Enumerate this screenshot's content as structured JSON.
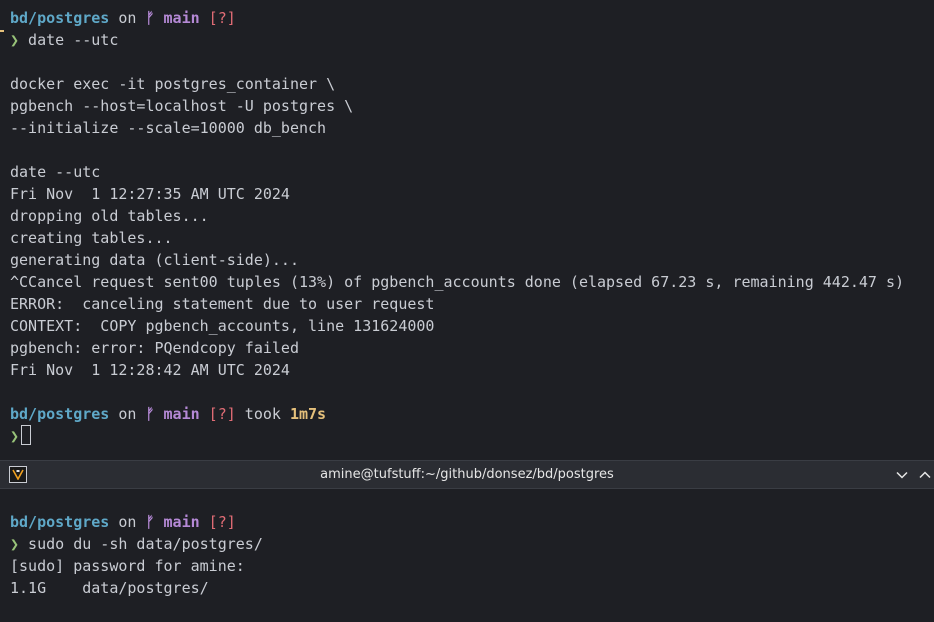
{
  "top_pane": {
    "prompt1": {
      "path": "bd/postgres",
      "on": " on ",
      "branch_glyph": "ᚠ",
      "branch": " main",
      "status": " [?]"
    },
    "cmd1_arrow": "❯",
    "cmd1": " date --utc",
    "lines": [
      "docker exec -it postgres_container \\",
      "pgbench --host=localhost -U postgres \\",
      "--initialize --scale=10000 db_bench",
      "",
      "date --utc",
      "Fri Nov  1 12:27:35 AM UTC 2024",
      "dropping old tables...",
      "creating tables...",
      "generating data (client-side)...",
      "^CCancel request sent00 tuples (13%) of pgbench_accounts done (elapsed 67.23 s, remaining 442.47 s)",
      "ERROR:  canceling statement due to user request",
      "CONTEXT:  COPY pgbench_accounts, line 131624000",
      "pgbench: error: PQendcopy failed",
      "Fri Nov  1 12:28:42 AM UTC 2024"
    ],
    "prompt2": {
      "path": "bd/postgres",
      "on": " on ",
      "branch_glyph": "ᚠ",
      "branch": " main",
      "status": " [?]",
      "took": " took ",
      "duration": "1m7s"
    },
    "cmd2_arrow": "❯"
  },
  "divider": {
    "title": "amine@tufstuff:~/github/donsez/bd/postgres",
    "icons": [
      "terminal-app-icon",
      "chevron-down-icon",
      "chevron-up-icon"
    ]
  },
  "bottom_pane": {
    "prompt": {
      "path": "bd/postgres",
      "on": " on ",
      "branch_glyph": "ᚠ",
      "branch": " main",
      "status": " [?]"
    },
    "cmd_arrow": "❯",
    "cmd": " sudo du -sh data/postgres/",
    "lines": [
      "[sudo] password for amine:",
      "1.1G    data/postgres/"
    ]
  },
  "colors": {
    "background": "#1e1f24",
    "path": "#5fa8c8",
    "branch": "#b589d6",
    "status": "#e06c75",
    "duration": "#e5c07b",
    "prompt": "#98c379"
  }
}
